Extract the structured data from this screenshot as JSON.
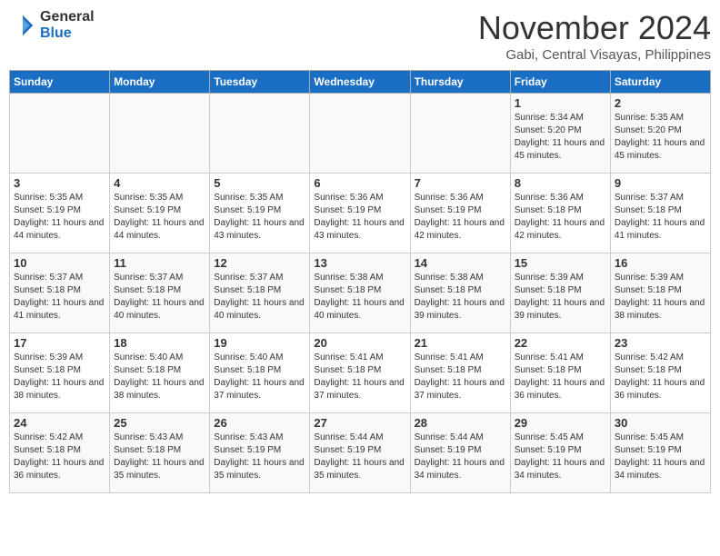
{
  "header": {
    "logo_general": "General",
    "logo_blue": "Blue",
    "month_title": "November 2024",
    "location": "Gabi, Central Visayas, Philippines"
  },
  "calendar": {
    "days_of_week": [
      "Sunday",
      "Monday",
      "Tuesday",
      "Wednesday",
      "Thursday",
      "Friday",
      "Saturday"
    ],
    "weeks": [
      [
        {
          "day": "",
          "empty": true
        },
        {
          "day": "",
          "empty": true
        },
        {
          "day": "",
          "empty": true
        },
        {
          "day": "",
          "empty": true
        },
        {
          "day": "",
          "empty": true
        },
        {
          "day": "1",
          "sunrise": "5:34 AM",
          "sunset": "5:20 PM",
          "daylight": "11 hours and 45 minutes."
        },
        {
          "day": "2",
          "sunrise": "5:35 AM",
          "sunset": "5:20 PM",
          "daylight": "11 hours and 45 minutes."
        }
      ],
      [
        {
          "day": "3",
          "sunrise": "5:35 AM",
          "sunset": "5:19 PM",
          "daylight": "11 hours and 44 minutes."
        },
        {
          "day": "4",
          "sunrise": "5:35 AM",
          "sunset": "5:19 PM",
          "daylight": "11 hours and 44 minutes."
        },
        {
          "day": "5",
          "sunrise": "5:35 AM",
          "sunset": "5:19 PM",
          "daylight": "11 hours and 43 minutes."
        },
        {
          "day": "6",
          "sunrise": "5:36 AM",
          "sunset": "5:19 PM",
          "daylight": "11 hours and 43 minutes."
        },
        {
          "day": "7",
          "sunrise": "5:36 AM",
          "sunset": "5:19 PM",
          "daylight": "11 hours and 42 minutes."
        },
        {
          "day": "8",
          "sunrise": "5:36 AM",
          "sunset": "5:18 PM",
          "daylight": "11 hours and 42 minutes."
        },
        {
          "day": "9",
          "sunrise": "5:37 AM",
          "sunset": "5:18 PM",
          "daylight": "11 hours and 41 minutes."
        }
      ],
      [
        {
          "day": "10",
          "sunrise": "5:37 AM",
          "sunset": "5:18 PM",
          "daylight": "11 hours and 41 minutes."
        },
        {
          "day": "11",
          "sunrise": "5:37 AM",
          "sunset": "5:18 PM",
          "daylight": "11 hours and 40 minutes."
        },
        {
          "day": "12",
          "sunrise": "5:37 AM",
          "sunset": "5:18 PM",
          "daylight": "11 hours and 40 minutes."
        },
        {
          "day": "13",
          "sunrise": "5:38 AM",
          "sunset": "5:18 PM",
          "daylight": "11 hours and 40 minutes."
        },
        {
          "day": "14",
          "sunrise": "5:38 AM",
          "sunset": "5:18 PM",
          "daylight": "11 hours and 39 minutes."
        },
        {
          "day": "15",
          "sunrise": "5:39 AM",
          "sunset": "5:18 PM",
          "daylight": "11 hours and 39 minutes."
        },
        {
          "day": "16",
          "sunrise": "5:39 AM",
          "sunset": "5:18 PM",
          "daylight": "11 hours and 38 minutes."
        }
      ],
      [
        {
          "day": "17",
          "sunrise": "5:39 AM",
          "sunset": "5:18 PM",
          "daylight": "11 hours and 38 minutes."
        },
        {
          "day": "18",
          "sunrise": "5:40 AM",
          "sunset": "5:18 PM",
          "daylight": "11 hours and 38 minutes."
        },
        {
          "day": "19",
          "sunrise": "5:40 AM",
          "sunset": "5:18 PM",
          "daylight": "11 hours and 37 minutes."
        },
        {
          "day": "20",
          "sunrise": "5:41 AM",
          "sunset": "5:18 PM",
          "daylight": "11 hours and 37 minutes."
        },
        {
          "day": "21",
          "sunrise": "5:41 AM",
          "sunset": "5:18 PM",
          "daylight": "11 hours and 37 minutes."
        },
        {
          "day": "22",
          "sunrise": "5:41 AM",
          "sunset": "5:18 PM",
          "daylight": "11 hours and 36 minutes."
        },
        {
          "day": "23",
          "sunrise": "5:42 AM",
          "sunset": "5:18 PM",
          "daylight": "11 hours and 36 minutes."
        }
      ],
      [
        {
          "day": "24",
          "sunrise": "5:42 AM",
          "sunset": "5:18 PM",
          "daylight": "11 hours and 36 minutes."
        },
        {
          "day": "25",
          "sunrise": "5:43 AM",
          "sunset": "5:18 PM",
          "daylight": "11 hours and 35 minutes."
        },
        {
          "day": "26",
          "sunrise": "5:43 AM",
          "sunset": "5:19 PM",
          "daylight": "11 hours and 35 minutes."
        },
        {
          "day": "27",
          "sunrise": "5:44 AM",
          "sunset": "5:19 PM",
          "daylight": "11 hours and 35 minutes."
        },
        {
          "day": "28",
          "sunrise": "5:44 AM",
          "sunset": "5:19 PM",
          "daylight": "11 hours and 34 minutes."
        },
        {
          "day": "29",
          "sunrise": "5:45 AM",
          "sunset": "5:19 PM",
          "daylight": "11 hours and 34 minutes."
        },
        {
          "day": "30",
          "sunrise": "5:45 AM",
          "sunset": "5:19 PM",
          "daylight": "11 hours and 34 minutes."
        }
      ]
    ]
  }
}
